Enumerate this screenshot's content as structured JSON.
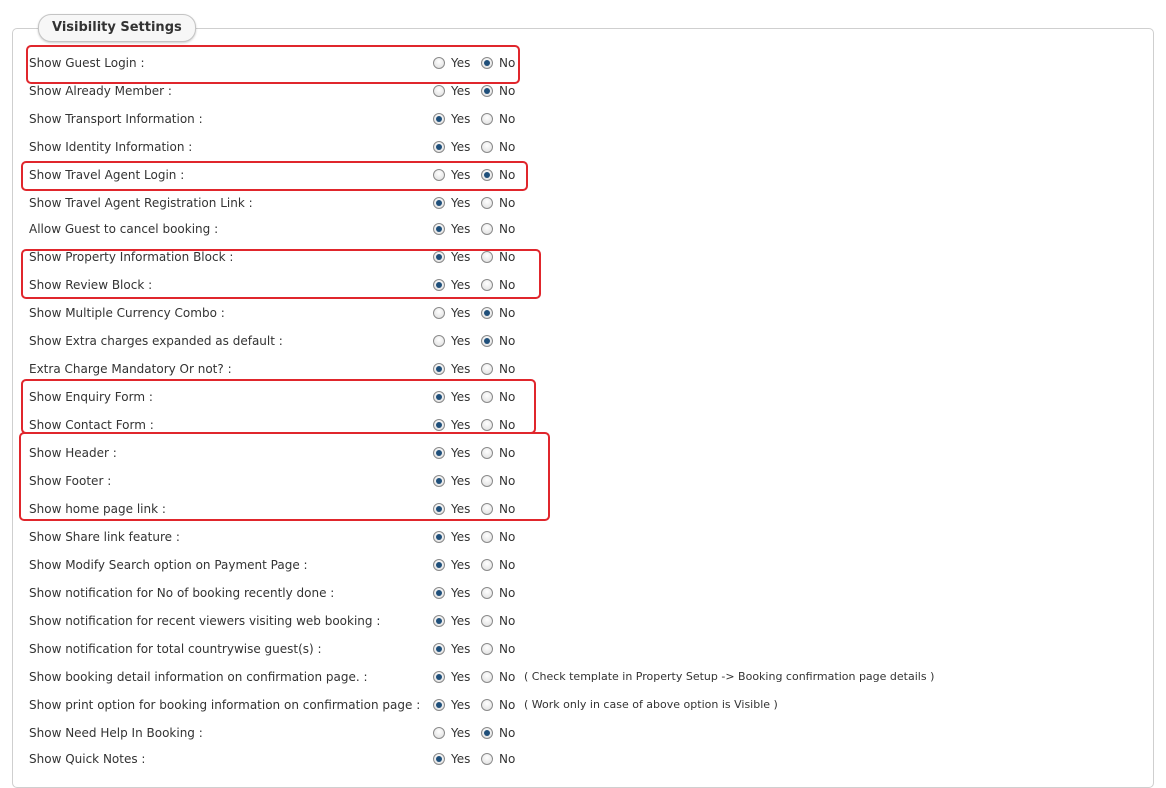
{
  "section_title": "Visibility Settings",
  "yes_label": "Yes",
  "no_label": "No",
  "settings": [
    {
      "label": "Show Guest Login :",
      "value": "No"
    },
    {
      "label": "Show Already Member :",
      "value": "No"
    },
    {
      "label": "Show Transport Information :",
      "value": "Yes"
    },
    {
      "label": "Show Identity Information :",
      "value": "Yes"
    },
    {
      "label": "Show Travel Agent Login :",
      "value": "No"
    },
    {
      "label": "Show Travel Agent Registration Link :",
      "value": "Yes"
    },
    {
      "label": "Allow Guest to cancel booking :",
      "value": "Yes"
    },
    {
      "label": "Show Property Information Block :",
      "value": "Yes"
    },
    {
      "label": "Show Review Block :",
      "value": "Yes"
    },
    {
      "label": "Show Multiple Currency Combo :",
      "value": "No"
    },
    {
      "label": "Show Extra charges expanded as default :",
      "value": "No"
    },
    {
      "label": "Extra Charge Mandatory Or not? :",
      "value": "Yes"
    },
    {
      "label": "Show Enquiry Form :",
      "value": "Yes"
    },
    {
      "label": "Show Contact Form :",
      "value": "Yes"
    },
    {
      "label": "Show Header :",
      "value": "Yes"
    },
    {
      "label": "Show Footer :",
      "value": "Yes"
    },
    {
      "label": "Show home page link :",
      "value": "Yes"
    },
    {
      "label": "Show Share link feature :",
      "value": "Yes"
    },
    {
      "label": "Show Modify Search option on Payment Page :",
      "value": "Yes"
    },
    {
      "label": "Show notification for No of booking recently done :",
      "value": "Yes"
    },
    {
      "label": "Show notification for recent viewers visiting web booking :",
      "value": "Yes"
    },
    {
      "label": "Show notification for total countrywise guest(s) :",
      "value": "Yes"
    },
    {
      "label": "Show booking detail information on confirmation page. :",
      "value": "Yes",
      "note": "( Check template in Property Setup -> Booking confirmation page details )"
    },
    {
      "label": "Show print option for booking information on confirmation page :",
      "value": "Yes",
      "note": "( Work only in case of above option is Visible )"
    },
    {
      "label": "Show Need Help In Booking :",
      "value": "No"
    },
    {
      "label": "Show Quick Notes :",
      "value": "Yes"
    }
  ],
  "highlight_color": "#e0262c"
}
